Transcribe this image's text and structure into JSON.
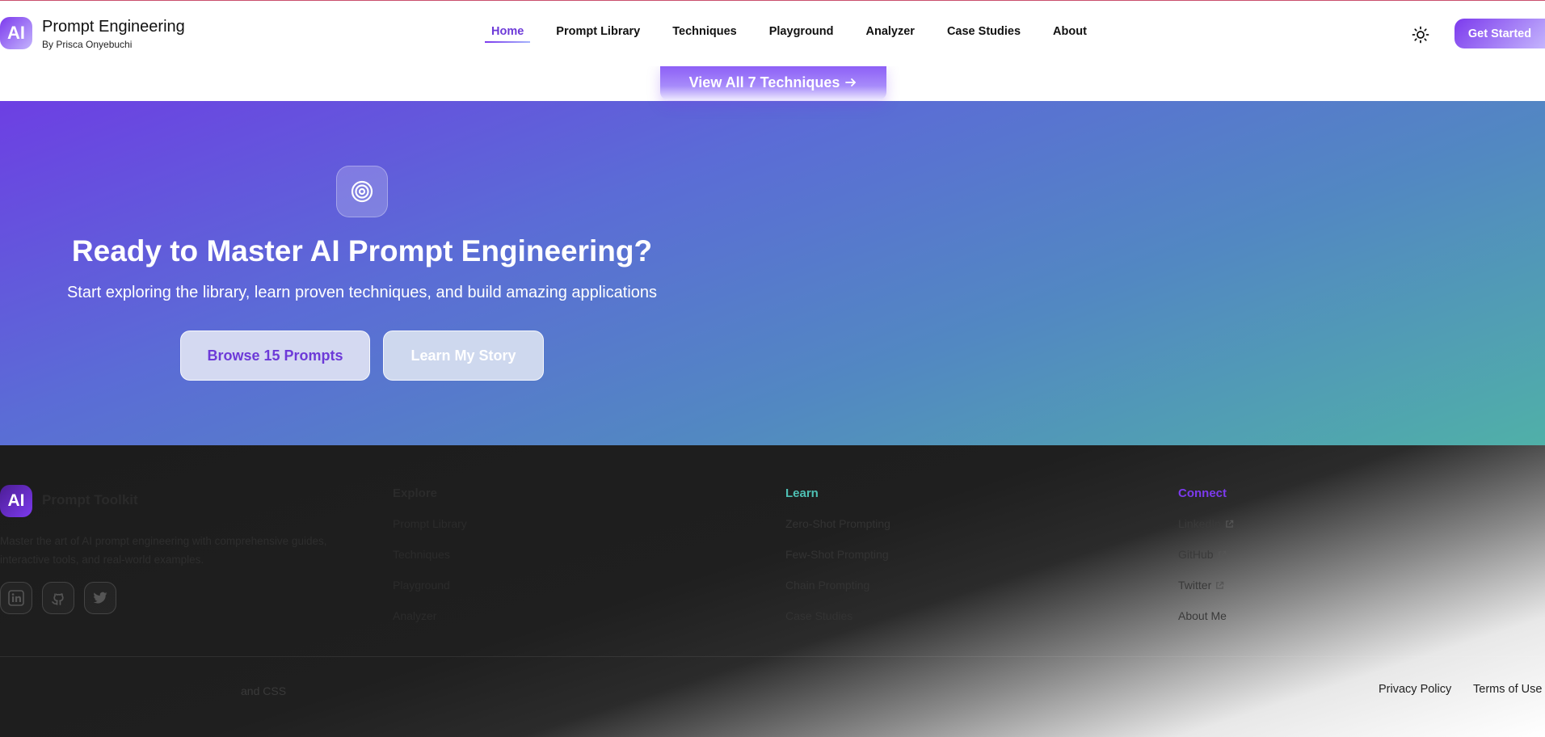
{
  "header": {
    "logo_text": "AI",
    "title": "Prompt Engineering",
    "subtitle": "By Prisca Onyebuchi",
    "nav": [
      {
        "label": "Home",
        "active": true
      },
      {
        "label": "Prompt Library",
        "active": false
      },
      {
        "label": "Techniques",
        "active": false
      },
      {
        "label": "Playground",
        "active": false
      },
      {
        "label": "Analyzer",
        "active": false
      },
      {
        "label": "Case Studies",
        "active": false
      },
      {
        "label": "About",
        "active": false
      }
    ],
    "theme_icon": "sun-icon",
    "cta_label": "Get Started"
  },
  "techniques_cta": {
    "label": "View All 7 Techniques",
    "icon": "arrow-right-icon"
  },
  "hero": {
    "icon": "target-icon",
    "title": "Ready to Master AI Prompt Engineering?",
    "subtitle": "Start exploring the library, learn proven techniques, and build amazing applications",
    "primary_button": "Browse 15 Prompts",
    "secondary_button": "Learn My Story"
  },
  "footer": {
    "logo_text": "AI",
    "brand": "Prompt Toolkit",
    "description": "Master the art of AI prompt engineering with comprehensive guides, interactive tools, and real-world examples.",
    "socials": [
      "linkedin-icon",
      "github-icon",
      "twitter-icon"
    ],
    "columns": {
      "explore": {
        "title": "Explore",
        "links": [
          "Prompt Library",
          "Techniques",
          "Playground",
          "Analyzer"
        ]
      },
      "learn": {
        "title": "Learn",
        "links": [
          "Zero-Shot Prompting",
          "Few-Shot Prompting",
          "Chain Prompting",
          "Case Studies"
        ]
      },
      "connect": {
        "title": "Connect",
        "links": [
          "LinkedIn",
          "GitHub",
          "Twitter",
          "About Me"
        ]
      }
    },
    "copyright": "and CSS",
    "privacy": "Privacy Policy",
    "terms": "Terms of Use"
  },
  "colors": {
    "accent": "#7c3aed",
    "teal": "#4ec0b4"
  }
}
